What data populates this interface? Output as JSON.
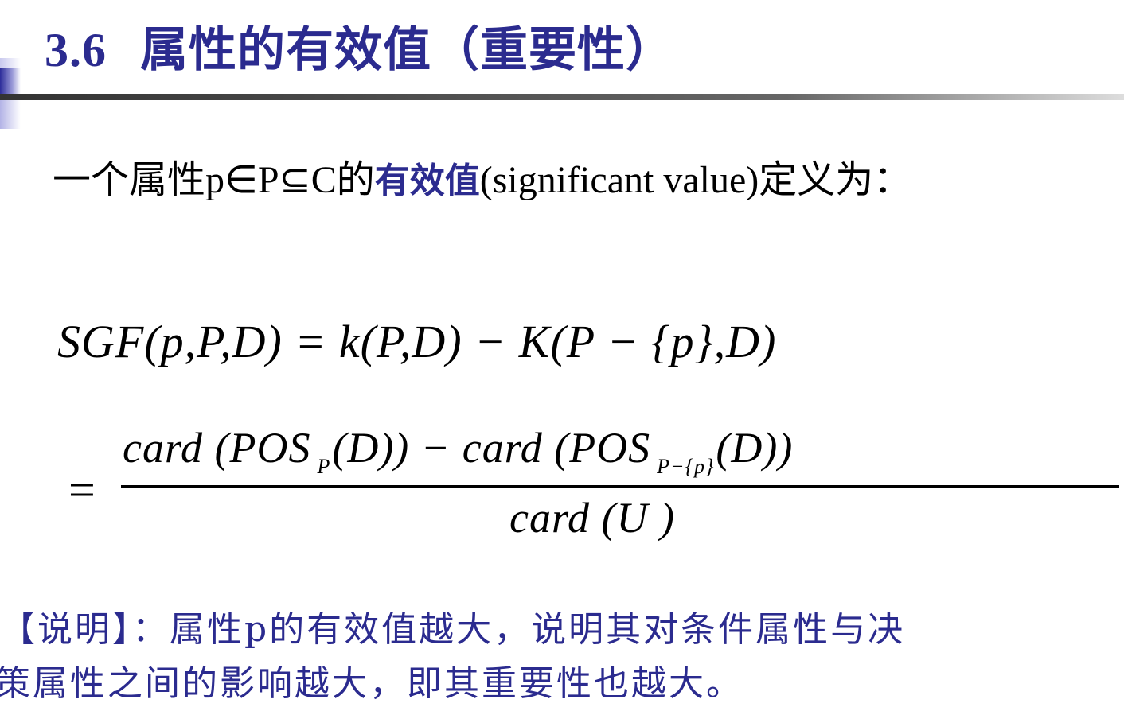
{
  "title": {
    "number": "3.6",
    "text": "属性的有效值（重要性）"
  },
  "intro": {
    "prefix": "一个属性p∈P⊆C的",
    "highlight": "有效值",
    "suffix": "(significant value)定义为："
  },
  "formula": {
    "line1": "SGF(p,P,D) = k(P,D) − K(P − {p},D)",
    "equals": "=",
    "numerator": {
      "part1": "card (POS",
      "sub1": "P",
      "part2": "(D)) − card (POS",
      "sub2": "P−{p}",
      "part3": "(D))"
    },
    "denominator": "card (U )"
  },
  "note": {
    "line1": "【说明】：属性p的有效值越大，说明其对条件属性与决",
    "line2": "策属性之间的影响越大，即其重要性也越大。"
  },
  "colors": {
    "accent": "#2b2b8f",
    "rule": "#444444"
  }
}
